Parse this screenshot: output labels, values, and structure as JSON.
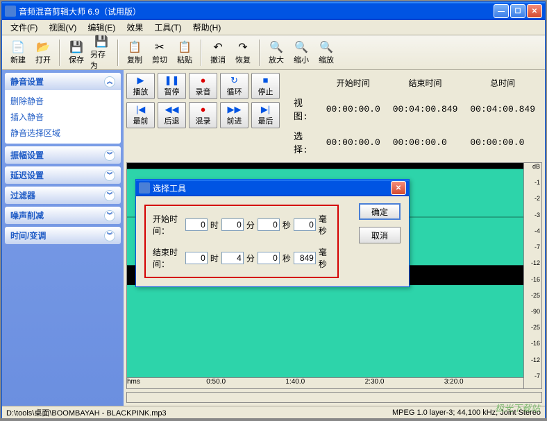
{
  "window": {
    "title": "音频混音剪辑大师 6.9（试用版）"
  },
  "menu": {
    "file": "文件(F)",
    "view": "视图(V)",
    "edit": "编辑(E)",
    "effect": "效果",
    "tools": "工具(T)",
    "help": "帮助(H)"
  },
  "toolbar": {
    "new": "新建",
    "open": "打开",
    "save": "保存",
    "saveas": "另存为",
    "copy": "复制",
    "cut": "剪切",
    "paste": "粘贴",
    "undo": "撤消",
    "redo": "恢复",
    "zoomin": "放大",
    "zoomout": "缩小",
    "zoom": "缩放"
  },
  "sidebar": {
    "panels": [
      {
        "title": "静音设置",
        "items": [
          "删除静音",
          "插入静音",
          "静音选择区域"
        ],
        "expanded": true
      },
      {
        "title": "振幅设置",
        "expanded": false
      },
      {
        "title": "延迟设置",
        "expanded": false
      },
      {
        "title": "过滤器",
        "expanded": false
      },
      {
        "title": "噪声削减",
        "expanded": false
      },
      {
        "title": "时间/变调",
        "expanded": false
      }
    ]
  },
  "transport": {
    "play": "播放",
    "pause": "暂停",
    "record": "录音",
    "loop": "循环",
    "stop": "停止",
    "first": "最前",
    "rewind": "后退",
    "mix": "混录",
    "forward": "前进",
    "last": "最后"
  },
  "timeinfo": {
    "start_label": "开始时间",
    "end_label": "结束时间",
    "total_label": "总时间",
    "view_label": "视图:",
    "select_label": "选择:",
    "view_start": "00:00:00.0",
    "view_end": "00:04:00.849",
    "view_total": "00:04:00.849",
    "select_start": "00:00:00.0",
    "select_end": "00:00:00.0",
    "select_total": "00:00:00.0"
  },
  "db_scale": [
    "dB",
    "-1",
    "-2",
    "-3",
    "-4",
    "-7",
    "-12",
    "-16",
    "-25",
    "-90",
    "-25",
    "-16",
    "-12",
    "-7"
  ],
  "time_axis": [
    "hms",
    "0:50.0",
    "1:40.0",
    "2:30.0",
    "3:20.0"
  ],
  "status": {
    "path": "D:\\tools\\桌面\\BOOMBAYAH - BLACKPINK.mp3",
    "format": "MPEG 1.0 layer-3; 44,100 kHz; Joint Stereo"
  },
  "dialog": {
    "title": "选择工具",
    "start_label": "开始时间：",
    "end_label": "结束时间：",
    "hour": "时",
    "min": "分",
    "sec": "秒",
    "ms": "毫秒",
    "start": {
      "h": "0",
      "m": "0",
      "s": "0",
      "ms": "0"
    },
    "end": {
      "h": "0",
      "m": "4",
      "s": "0",
      "ms": "849"
    },
    "ok": "确定",
    "cancel": "取消"
  },
  "watermark": "极光下载站"
}
